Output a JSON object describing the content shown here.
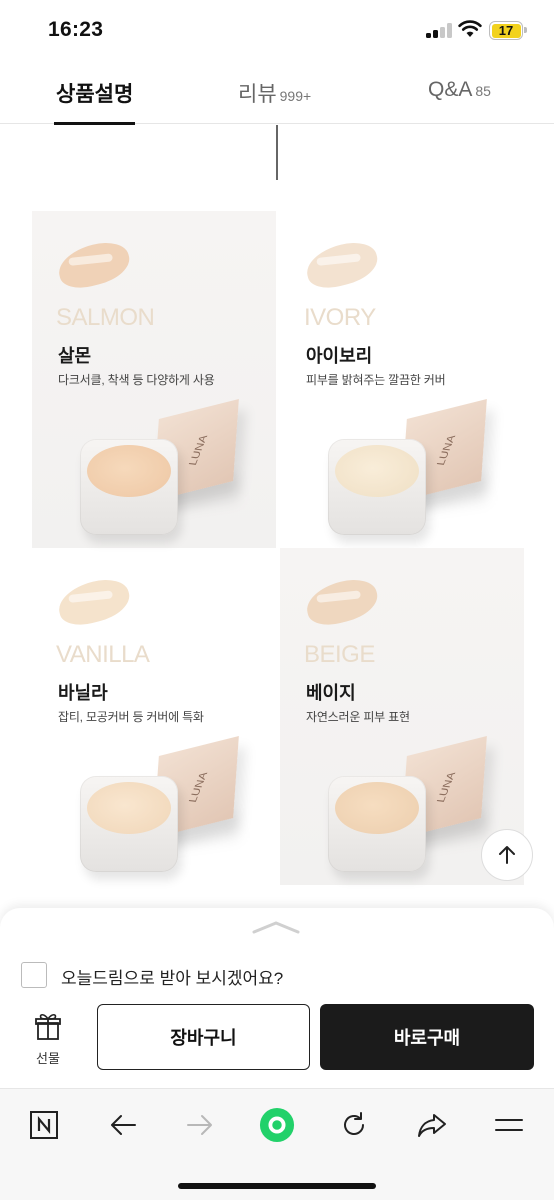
{
  "status_bar": {
    "time": "16:23",
    "battery": "17"
  },
  "tabs": [
    {
      "label": "상품설명",
      "count": ""
    },
    {
      "label": "리뷰",
      "count": "999+"
    },
    {
      "label": "Q&A",
      "count": "85"
    }
  ],
  "products": [
    {
      "eng": "SALMON",
      "name": "살몬",
      "desc": "다크서클, 착색 등 다양하게 사용",
      "swatch_color": "#f0d2b7",
      "cream_color": "#f2cfae",
      "brand": "LUNA"
    },
    {
      "eng": "IVORY",
      "name": "아이보리",
      "desc": "피부를 밝혀주는 깔끔한 커버",
      "swatch_color": "#f3e2d0",
      "cream_color": "#f5e7cf",
      "brand": "LUNA"
    },
    {
      "eng": "VANILLA",
      "name": "바닐라",
      "desc": "잡티, 모공커버 등 커버에 특화",
      "swatch_color": "#f5e3cc",
      "cream_color": "#f6dfc3",
      "brand": "LUNA"
    },
    {
      "eng": "BEIGE",
      "name": "베이지",
      "desc": "자연스러운 피부 표현",
      "swatch_color": "#efd7bf",
      "cream_color": "#f1d6b8",
      "brand": "LUNA"
    }
  ],
  "bottom_sheet": {
    "delivery_option": "오늘드림으로 받아 보시겠어요?",
    "gift_label": "선물",
    "cart_label": "장바구니",
    "buy_label": "바로구매"
  },
  "colors": {
    "accent_green": "#22d16a",
    "buy_button": "#1b1b1b"
  },
  "toolbar_icons": [
    "naver-n-icon",
    "back-arrow-icon",
    "forward-arrow-icon",
    "green-home-icon",
    "refresh-icon",
    "share-icon",
    "menu-icon"
  ]
}
